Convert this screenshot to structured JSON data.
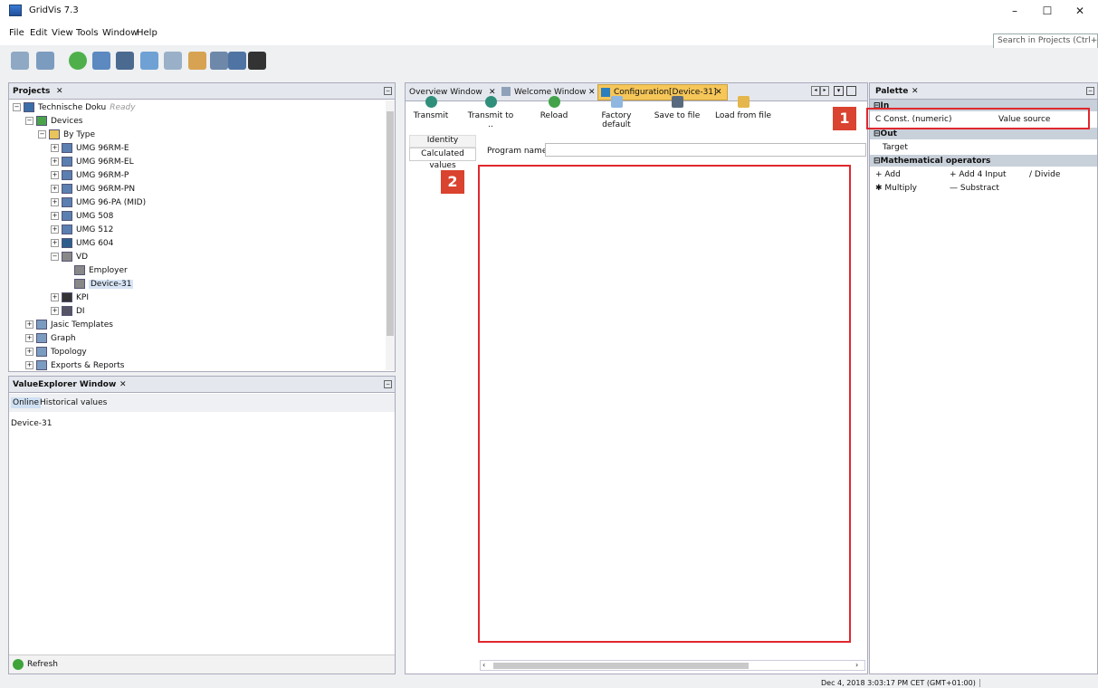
{
  "window": {
    "title": "GridVis 7.3",
    "minimize": "–",
    "maximize": "☐",
    "close": "✕"
  },
  "menu": [
    "File",
    "Edit",
    "View",
    "Tools",
    "Window",
    "Help"
  ],
  "search": {
    "placeholder": "Search in Projects (Ctrl+I)"
  },
  "projects": {
    "tab": "Projects",
    "tree": [
      {
        "label": "Technische Doku",
        "status": "Ready",
        "indent": 0,
        "exp": "−"
      },
      {
        "label": "Devices",
        "indent": 1,
        "exp": "−"
      },
      {
        "label": "By Type",
        "indent": 2,
        "exp": "−"
      },
      {
        "label": "UMG 96RM-E",
        "indent": 3,
        "exp": "+"
      },
      {
        "label": "UMG 96RM-EL",
        "indent": 3,
        "exp": "+"
      },
      {
        "label": "UMG 96RM-P",
        "indent": 3,
        "exp": "+"
      },
      {
        "label": "UMG 96RM-PN",
        "indent": 3,
        "exp": "+"
      },
      {
        "label": "UMG 96-PA (MID)",
        "indent": 3,
        "exp": "+"
      },
      {
        "label": "UMG 508",
        "indent": 3,
        "exp": "+"
      },
      {
        "label": "UMG 512",
        "indent": 3,
        "exp": "+"
      },
      {
        "label": "UMG 604",
        "indent": 3,
        "exp": "+"
      },
      {
        "label": "VD",
        "indent": 3,
        "exp": "−"
      },
      {
        "label": "Employer",
        "indent": 4,
        "exp": ""
      },
      {
        "label": "Device-31",
        "indent": 4,
        "exp": "",
        "selected": true
      },
      {
        "label": "KPI",
        "indent": 3,
        "exp": "+"
      },
      {
        "label": "DI",
        "indent": 3,
        "exp": "+"
      },
      {
        "label": "Jasic Templates",
        "indent": 1,
        "exp": "+"
      },
      {
        "label": "Graph",
        "indent": 1,
        "exp": "+"
      },
      {
        "label": "Topology",
        "indent": 1,
        "exp": "+"
      },
      {
        "label": "Exports & Reports",
        "indent": 1,
        "exp": "+"
      }
    ]
  },
  "value_explorer": {
    "tab": "ValueExplorer Window",
    "subtabs": [
      "Online",
      "Historical values"
    ],
    "device": "Device-31",
    "refresh": "Refresh"
  },
  "editor": {
    "tabs": [
      "Overview Window",
      "Welcome Window",
      "Configuration[Device-31]"
    ],
    "buttons": [
      "Transmit",
      "Transmit to ..",
      "Reload",
      "Factory default",
      "Save to file",
      "Load from file"
    ],
    "side_tabs": [
      "Identity",
      "Calculated values"
    ],
    "program_name_label": "Program name",
    "program_name_value": ""
  },
  "palette": {
    "tab": "Palette",
    "sections": {
      "in": "In",
      "out": "Out",
      "math": "Mathematical operators"
    },
    "in_items": [
      "C Const. (numeric)",
      "Value source"
    ],
    "out_items": [
      "Target"
    ],
    "math_items": [
      "+ Add",
      "+ Add 4 Input",
      "/ Divide",
      "✱ Multiply",
      "— Substract"
    ]
  },
  "callouts": [
    "1",
    "2"
  ],
  "status": {
    "datetime": "Dec 4, 2018 3:03:17 PM CET (GMT+01:00)"
  },
  "colors": {
    "accent": "#e0282e",
    "callout": "#d9432f",
    "selected_tab": "#f6c659",
    "section": "#c8d0da"
  }
}
